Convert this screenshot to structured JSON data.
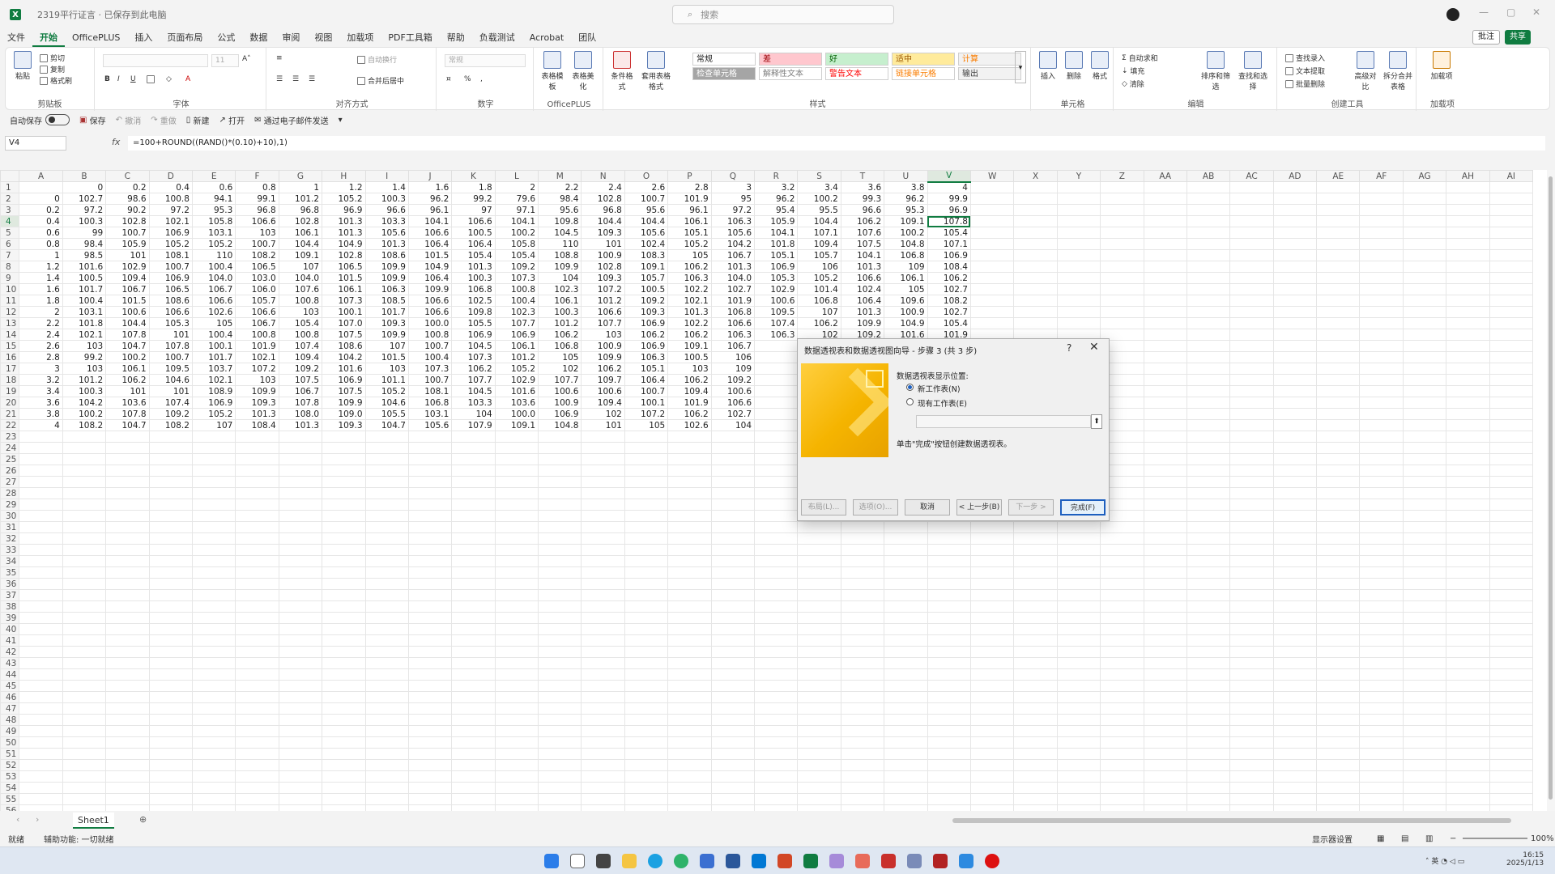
{
  "window": {
    "title": "2319平行证言 · 已保存到此电脑",
    "search_placeholder": "搜索"
  },
  "menu": {
    "tabs": [
      "文件",
      "开始",
      "OfficePLUS",
      "插入",
      "页面布局",
      "公式",
      "数据",
      "审阅",
      "视图",
      "加载项",
      "PDF工具箱",
      "帮助",
      "负载测试",
      "Acrobat",
      "团队"
    ],
    "active": "开始",
    "comment_label": "批注",
    "share_label": "共享"
  },
  "ribbon": {
    "clipboard": {
      "label": "剪贴板",
      "paste": "粘贴",
      "cut": "剪切",
      "copy": "复制",
      "format_painter": "格式刷"
    },
    "font": {
      "label": "字体",
      "size": "11"
    },
    "alignment": {
      "label": "对齐方式",
      "wrap": "自动换行",
      "merge": "合并后居中"
    },
    "number": {
      "label": "数字",
      "format": "常规"
    },
    "officeplus": {
      "label": "OfficePLUS",
      "btn1": "表格模板",
      "btn2": "表格美化"
    },
    "styles": {
      "label": "样式",
      "cond_format": "条件格式",
      "table_format": "套用表格格式",
      "cells": [
        {
          "text": "常规",
          "bg": "#ffffff",
          "fg": "#222222"
        },
        {
          "text": "差",
          "bg": "#ffc7ce",
          "fg": "#9c0006"
        },
        {
          "text": "好",
          "bg": "#c6efce",
          "fg": "#006100"
        },
        {
          "text": "适中",
          "bg": "#ffeb9c",
          "fg": "#9c5700"
        },
        {
          "text": "计算",
          "bg": "#f2f2f2",
          "fg": "#fa7d00"
        },
        {
          "text": "检查单元格",
          "bg": "#a5a5a5",
          "fg": "#ffffff"
        },
        {
          "text": "解释性文本",
          "bg": "#ffffff",
          "fg": "#7f7f7f"
        },
        {
          "text": "警告文本",
          "bg": "#ffffff",
          "fg": "#ff0000"
        },
        {
          "text": "链接单元格",
          "bg": "#ffffff",
          "fg": "#fa7d00"
        },
        {
          "text": "输出",
          "bg": "#f2f2f2",
          "fg": "#3f3f3f"
        }
      ]
    },
    "cells_group": {
      "label": "单元格",
      "insert": "插入",
      "delete": "删除",
      "format": "格式"
    },
    "editing": {
      "label": "编辑",
      "autosum": "自动求和",
      "fill": "填充",
      "clear": "清除",
      "sort": "排序和筛选",
      "find": "查找和选择"
    },
    "tools": {
      "label": "创建工具",
      "batch_rename": "查找录入",
      "text_extract": "文本提取",
      "batch_delete": "批量删除",
      "compare": "高级对比",
      "split": "拆分合并表格"
    },
    "addins": {
      "label": "加载项",
      "btn": "加载项"
    }
  },
  "qat": {
    "autosave": "自动保存",
    "save": "保存",
    "undo": "撤消",
    "redo": "重做",
    "new": "新建",
    "open": "打开",
    "email": "通过电子邮件发送"
  },
  "formula_bar": {
    "name_box": "V4",
    "fx": "fx",
    "formula": "=100+ROUND((RAND()*(0.10)+10),1)"
  },
  "sheet": {
    "columns": [
      "A",
      "B",
      "C",
      "D",
      "E",
      "F",
      "G",
      "H",
      "I",
      "J",
      "K",
      "L",
      "M",
      "N",
      "O",
      "P",
      "Q",
      "R",
      "S",
      "T",
      "U",
      "V",
      "W",
      "X",
      "Y",
      "Z",
      "AA",
      "AB",
      "AC",
      "AD",
      "AE",
      "AF",
      "AG",
      "AH",
      "AI"
    ],
    "active_col": "V",
    "active_row": 4,
    "total_rows": 56,
    "rows": [
      [
        "",
        "0",
        "0.2",
        "0.4",
        "0.6",
        "0.8",
        "1",
        "1.2",
        "1.4",
        "1.6",
        "1.8",
        "2",
        "2.2",
        "2.4",
        "2.6",
        "2.8",
        "3",
        "3.2",
        "3.4",
        "3.6",
        "3.8",
        "4"
      ],
      [
        "0",
        "102.7",
        "98.6",
        "100.8",
        "94.1",
        "99.1",
        "101.2",
        "105.2",
        "100.3",
        "96.2",
        "99.2",
        "79.6",
        "98.4",
        "102.8",
        "100.7",
        "101.9",
        "95",
        "96.2",
        "100.2",
        "99.3",
        "96.2",
        "99.9"
      ],
      [
        "0.2",
        "97.2",
        "90.2",
        "97.2",
        "95.3",
        "96.8",
        "96.8",
        "96.9",
        "96.6",
        "96.1",
        "97",
        "97.1",
        "95.6",
        "96.8",
        "95.6",
        "96.1",
        "97.2",
        "95.4",
        "95.5",
        "96.6",
        "95.3",
        "96.9"
      ],
      [
        "0.4",
        "100.3",
        "102.8",
        "102.1",
        "105.8",
        "106.6",
        "102.8",
        "101.3",
        "103.3",
        "104.1",
        "106.6",
        "104.1",
        "109.8",
        "104.4",
        "104.4",
        "106.1",
        "106.3",
        "105.9",
        "104.4",
        "106.2",
        "109.1",
        "107.8"
      ],
      [
        "0.6",
        "99",
        "100.7",
        "106.9",
        "103.1",
        "103",
        "106.1",
        "101.3",
        "105.6",
        "106.6",
        "100.5",
        "100.2",
        "104.5",
        "109.3",
        "105.6",
        "105.1",
        "105.6",
        "104.1",
        "107.1",
        "107.6",
        "100.2",
        "105.4"
      ],
      [
        "0.8",
        "98.4",
        "105.9",
        "105.2",
        "105.2",
        "100.7",
        "104.4",
        "104.9",
        "101.3",
        "106.4",
        "106.4",
        "105.8",
        "110",
        "101",
        "102.4",
        "105.2",
        "104.2",
        "101.8",
        "109.4",
        "107.5",
        "104.8",
        "107.1"
      ],
      [
        "1",
        "98.5",
        "101",
        "108.1",
        "110",
        "108.2",
        "109.1",
        "102.8",
        "108.6",
        "101.5",
        "105.4",
        "105.4",
        "108.8",
        "100.9",
        "108.3",
        "105",
        "106.7",
        "105.1",
        "105.7",
        "104.1",
        "106.8",
        "106.9"
      ],
      [
        "1.2",
        "101.6",
        "102.9",
        "100.7",
        "100.4",
        "106.5",
        "107",
        "106.5",
        "109.9",
        "104.9",
        "101.3",
        "109.2",
        "109.9",
        "102.8",
        "109.1",
        "106.2",
        "101.3",
        "106.9",
        "106",
        "101.3",
        "109",
        "108.4"
      ],
      [
        "1.4",
        "100.5",
        "109.4",
        "106.9",
        "104.0",
        "103.0",
        "104.0",
        "101.5",
        "109.9",
        "106.4",
        "100.3",
        "107.3",
        "104",
        "109.3",
        "105.7",
        "106.3",
        "104.0",
        "105.3",
        "105.2",
        "106.6",
        "106.1",
        "106.2"
      ],
      [
        "1.6",
        "101.7",
        "106.7",
        "106.5",
        "106.7",
        "106.0",
        "107.6",
        "106.1",
        "106.3",
        "109.9",
        "106.8",
        "100.8",
        "102.3",
        "107.2",
        "100.5",
        "102.2",
        "102.7",
        "102.9",
        "101.4",
        "102.4",
        "105",
        "102.7"
      ],
      [
        "1.8",
        "100.4",
        "101.5",
        "108.6",
        "106.6",
        "105.7",
        "100.8",
        "107.3",
        "108.5",
        "106.6",
        "102.5",
        "100.4",
        "106.1",
        "101.2",
        "109.2",
        "102.1",
        "101.9",
        "100.6",
        "106.8",
        "106.4",
        "109.6",
        "108.2"
      ],
      [
        "2",
        "103.1",
        "100.6",
        "106.6",
        "102.6",
        "106.6",
        "103",
        "100.1",
        "101.7",
        "106.6",
        "109.8",
        "102.3",
        "100.3",
        "106.6",
        "109.3",
        "101.3",
        "106.8",
        "109.5",
        "107",
        "101.3",
        "100.9",
        "102.7"
      ],
      [
        "2.2",
        "101.8",
        "104.4",
        "105.3",
        "105",
        "106.7",
        "105.4",
        "107.0",
        "109.3",
        "100.0",
        "105.5",
        "107.7",
        "101.2",
        "107.7",
        "106.9",
        "102.2",
        "106.6",
        "107.4",
        "106.2",
        "109.9",
        "104.9",
        "105.4"
      ],
      [
        "2.4",
        "102.1",
        "107.8",
        "101",
        "100.4",
        "100.8",
        "100.8",
        "107.5",
        "109.9",
        "100.8",
        "106.9",
        "106.9",
        "106.2",
        "103",
        "106.2",
        "106.2",
        "106.3",
        "106.3",
        "102",
        "109.2",
        "101.6",
        "101.9"
      ],
      [
        "2.6",
        "103",
        "104.7",
        "107.8",
        "100.1",
        "101.9",
        "107.4",
        "108.6",
        "107",
        "100.7",
        "104.5",
        "106.1",
        "106.8",
        "100.9",
        "106.9",
        "109.1",
        "106.7",
        "",
        "",
        "",
        "",
        ""
      ],
      [
        "2.8",
        "99.2",
        "100.2",
        "100.7",
        "101.7",
        "102.1",
        "109.4",
        "104.2",
        "101.5",
        "100.4",
        "107.3",
        "101.2",
        "105",
        "109.9",
        "106.3",
        "100.5",
        "106",
        "",
        "",
        "",
        "",
        ""
      ],
      [
        "3",
        "103",
        "106.1",
        "109.5",
        "103.7",
        "107.2",
        "109.2",
        "101.6",
        "103",
        "107.3",
        "106.2",
        "105.2",
        "102",
        "106.2",
        "105.1",
        "103",
        "109",
        "",
        "",
        "",
        "",
        ""
      ],
      [
        "3.2",
        "101.2",
        "106.2",
        "104.6",
        "102.1",
        "103",
        "107.5",
        "106.9",
        "101.1",
        "100.7",
        "107.7",
        "102.9",
        "107.7",
        "109.7",
        "106.4",
        "106.2",
        "109.2",
        "",
        "",
        "",
        "",
        ""
      ],
      [
        "3.4",
        "100.3",
        "101",
        "101",
        "108.9",
        "109.9",
        "106.7",
        "107.5",
        "105.2",
        "108.1",
        "104.5",
        "101.6",
        "100.6",
        "100.6",
        "100.7",
        "109.4",
        "100.6",
        "",
        "",
        "",
        "",
        ""
      ],
      [
        "3.6",
        "104.2",
        "103.6",
        "107.4",
        "106.9",
        "109.3",
        "107.8",
        "109.9",
        "104.6",
        "106.8",
        "103.3",
        "103.6",
        "100.9",
        "109.4",
        "100.1",
        "101.9",
        "106.6",
        "",
        "",
        "",
        "",
        ""
      ],
      [
        "3.8",
        "100.2",
        "107.8",
        "109.2",
        "105.2",
        "101.3",
        "108.0",
        "109.0",
        "105.5",
        "103.1",
        "104",
        "100.0",
        "106.9",
        "102",
        "107.2",
        "106.2",
        "102.7",
        "",
        "",
        "",
        "",
        ""
      ],
      [
        "4",
        "108.2",
        "104.7",
        "108.2",
        "107",
        "108.4",
        "101.3",
        "109.3",
        "104.7",
        "105.6",
        "107.9",
        "109.1",
        "104.8",
        "101",
        "105",
        "102.6",
        "104",
        "",
        "",
        "",
        "",
        ""
      ]
    ]
  },
  "sheet_tabs": {
    "name": "Sheet1"
  },
  "status": {
    "ready": "就绪",
    "accessibility": "辅助功能: 一切就绪",
    "display_settings": "显示器设置",
    "zoom": "100%"
  },
  "taskbar": {
    "time": "16:15",
    "date": "2025/1/13"
  },
  "dialog": {
    "title": "数据透视表和数据透视图向导 - 步骤 3 (共 3 步)",
    "help": "?",
    "close": "✕",
    "question": "数据透视表显示位置:",
    "opt_new": "新工作表(N)",
    "opt_existing": "现有工作表(E)",
    "hint": "单击\"完成\"按钮创建数据透视表。",
    "btn_layout": "布局(L)...",
    "btn_options": "选项(O)...",
    "btn_cancel": "取消",
    "btn_prev": "< 上一步(B)",
    "btn_next": "下一步 >",
    "btn_finish": "完成(F)"
  }
}
